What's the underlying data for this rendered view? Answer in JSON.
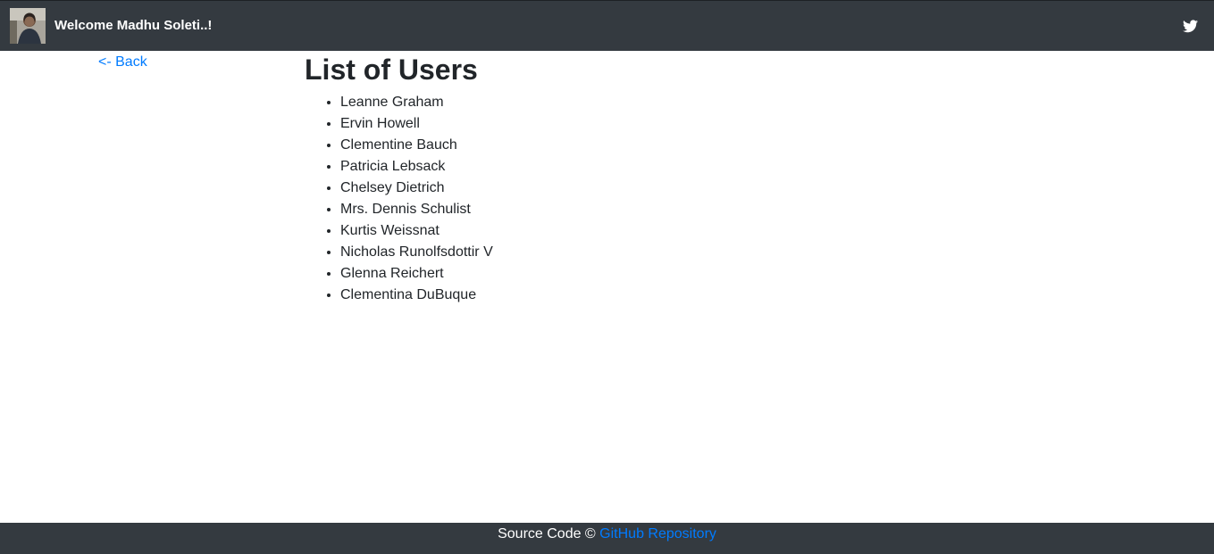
{
  "navbar": {
    "brand": "Welcome Madhu Soleti..!",
    "avatar_icon": "user-photo-icon",
    "social_icon": "twitter-icon",
    "background": "#343a40"
  },
  "back_link": "<- Back",
  "title": "List of Users",
  "users": [
    "Leanne Graham",
    "Ervin Howell",
    "Clementine Bauch",
    "Patricia Lebsack",
    "Chelsey Dietrich",
    "Mrs. Dennis Schulist",
    "Kurtis Weissnat",
    "Nicholas Runolfsdottir V",
    "Glenna Reichert",
    "Clementina DuBuque"
  ],
  "footer": {
    "text": "Source Code ©",
    "link_label": "GitHub Repository"
  },
  "colors": {
    "link": "#007bff",
    "text": "#212529"
  }
}
